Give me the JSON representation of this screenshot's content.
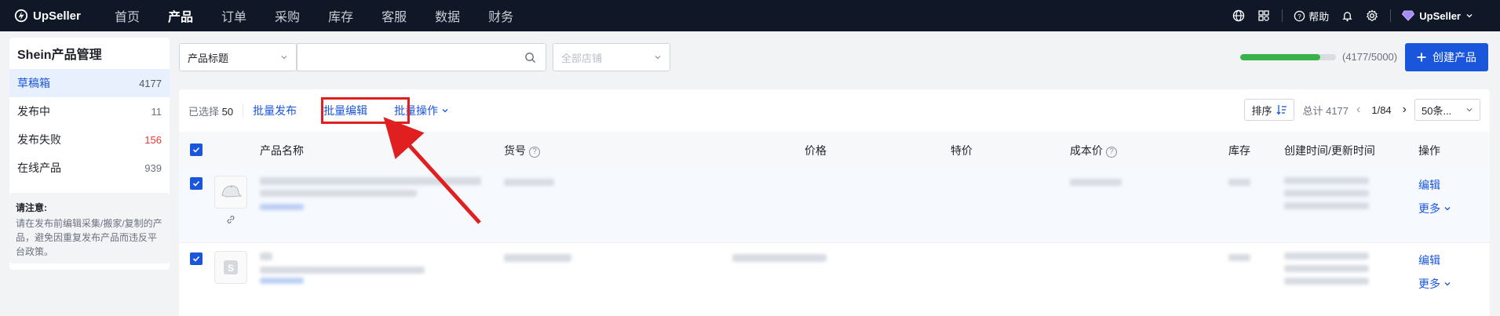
{
  "app": {
    "brand": "UpSeller"
  },
  "nav": {
    "items": [
      "首页",
      "产品",
      "订单",
      "采购",
      "库存",
      "客服",
      "数据",
      "财务"
    ],
    "active_index": 1
  },
  "topbar": {
    "help_label": "帮助",
    "user_label": "UpSeller"
  },
  "sidebar": {
    "title": "Shein产品管理",
    "items": [
      {
        "label": "草稿箱",
        "count": "4177"
      },
      {
        "label": "发布中",
        "count": "11"
      },
      {
        "label": "发布失败",
        "count": "156"
      },
      {
        "label": "在线产品",
        "count": "939"
      }
    ],
    "notice_title": "请注意:",
    "notice_text": "请在发布前编辑采集/搬家/复制的产品，避免因重复发布产品而违反平台政策。"
  },
  "search": {
    "field_select": "产品标题",
    "input_value": "",
    "store_placeholder": "全部店铺"
  },
  "quota": {
    "text": "(4177/5000)",
    "fraction": 0.8354
  },
  "create_button": "创建产品",
  "toolbar": {
    "selected_label": "已选择",
    "selected_count": "50",
    "batch_publish": "批量发布",
    "batch_edit": "批量编辑",
    "batch_ops": "批量操作",
    "sort_label": "排序",
    "total": "总计 4177",
    "page": "1/84",
    "page_size": "50条..."
  },
  "table": {
    "headers": {
      "name": "产品名称",
      "sku": "货号",
      "price": "价格",
      "special": "特价",
      "cost": "成本价",
      "stock": "库存",
      "time": "创建时间/更新时间",
      "ops": "操作"
    },
    "row_actions": {
      "edit": "编辑",
      "more": "更多"
    }
  },
  "colors": {
    "brand": "#1a56db",
    "topbar": "#101828",
    "highlight": "#e02020",
    "progress": "#3cb34a"
  }
}
